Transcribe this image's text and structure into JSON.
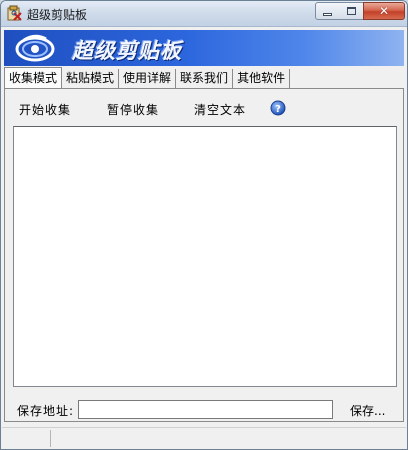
{
  "window": {
    "title": "超级剪贴板"
  },
  "banner": {
    "title": "超级剪贴板"
  },
  "tabs": [
    {
      "label": "收集模式"
    },
    {
      "label": "粘贴模式"
    },
    {
      "label": "使用详解"
    },
    {
      "label": "联系我们"
    },
    {
      "label": "其他软件"
    }
  ],
  "toolbar": {
    "start_label": "开始收集",
    "pause_label": "暂停收集",
    "clear_label": "清空文本",
    "help_icon": "help-icon"
  },
  "content": {
    "text": ""
  },
  "save": {
    "label": "保存地址:",
    "path_value": "",
    "button_label": "保存..."
  },
  "colors": {
    "banner_start": "#1f4fbf",
    "banner_end": "#8fb3f0",
    "close_button": "#c4402a"
  }
}
